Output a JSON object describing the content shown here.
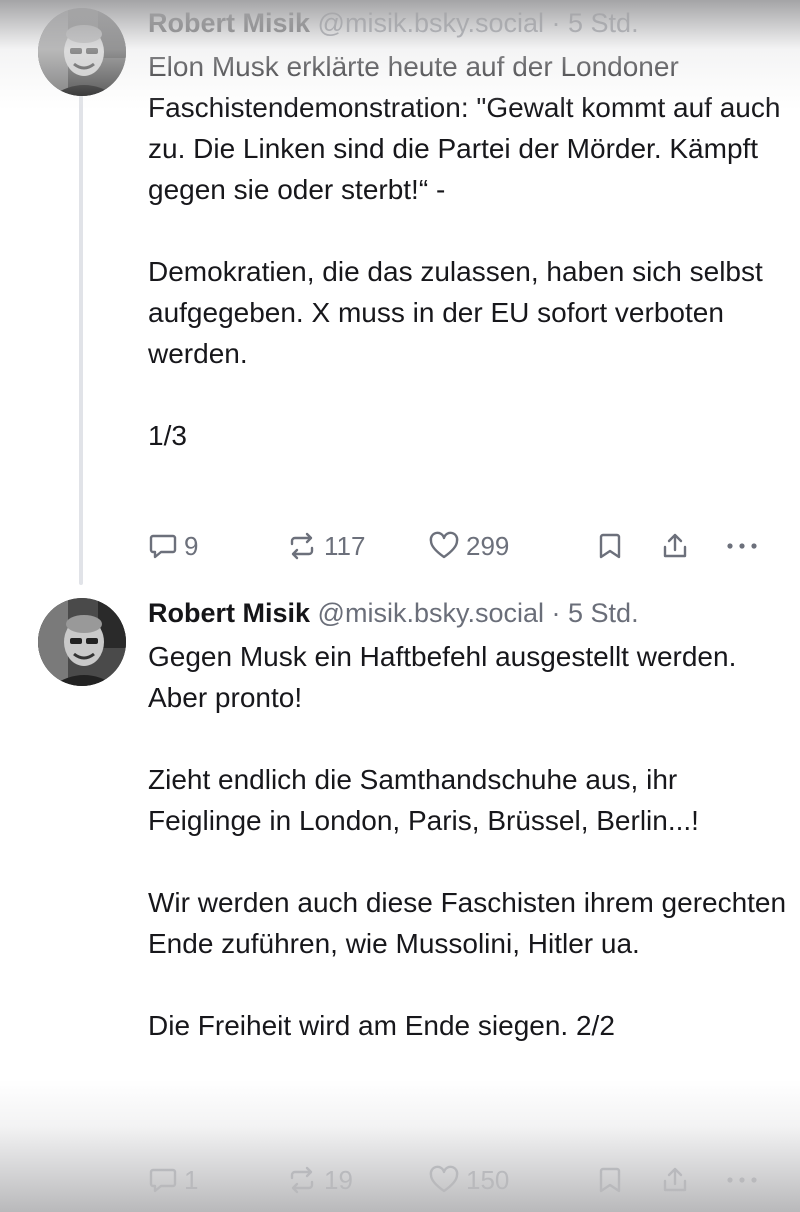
{
  "posts": [
    {
      "author_name": "Robert Misik",
      "handle": "@misik.bsky.social",
      "separator": "·",
      "time": "5 Std.",
      "paragraphs": [
        "Elon Musk erklärte heute auf der Londoner Faschistendemonstration: \"Gewalt kommt auf auch zu. Die Linken sind die Partei der Mörder. Kämpft gegen sie oder sterbt!“ -",
        "Demokratien, die das zulassen, haben sich selbst aufgegeben. X muss in der EU sofort verboten werden.",
        "1/3"
      ],
      "reply_count": "9",
      "repost_count": "117",
      "like_count": "299"
    },
    {
      "author_name": "Robert Misik",
      "handle": "@misik.bsky.social",
      "separator": "·",
      "time": "5 Std.",
      "paragraphs": [
        "Gegen Musk ein Haftbefehl ausgestellt werden. Aber pronto!",
        "Zieht endlich die Samthandschuhe aus, ihr Feiglinge in London, Paris, Brüssel, Berlin...!",
        "Wir werden auch diese Faschisten ihrem gerechten Ende zuführen, wie Mussolini, Hitler ua.",
        "Die Freiheit wird am Ende siegen. 2/2"
      ],
      "reply_count": "1",
      "repost_count": "19",
      "like_count": "150"
    }
  ],
  "icons": {
    "reply": "speech-bubble-icon",
    "repost": "repost-arrows-icon",
    "like": "heart-outline-icon",
    "bookmark": "bookmark-icon",
    "share": "share-upload-icon",
    "more": "more-horizontal-icon"
  },
  "colors": {
    "text": "#17171b",
    "muted": "#6a6e79",
    "thread_line": "#e1e3e8"
  }
}
